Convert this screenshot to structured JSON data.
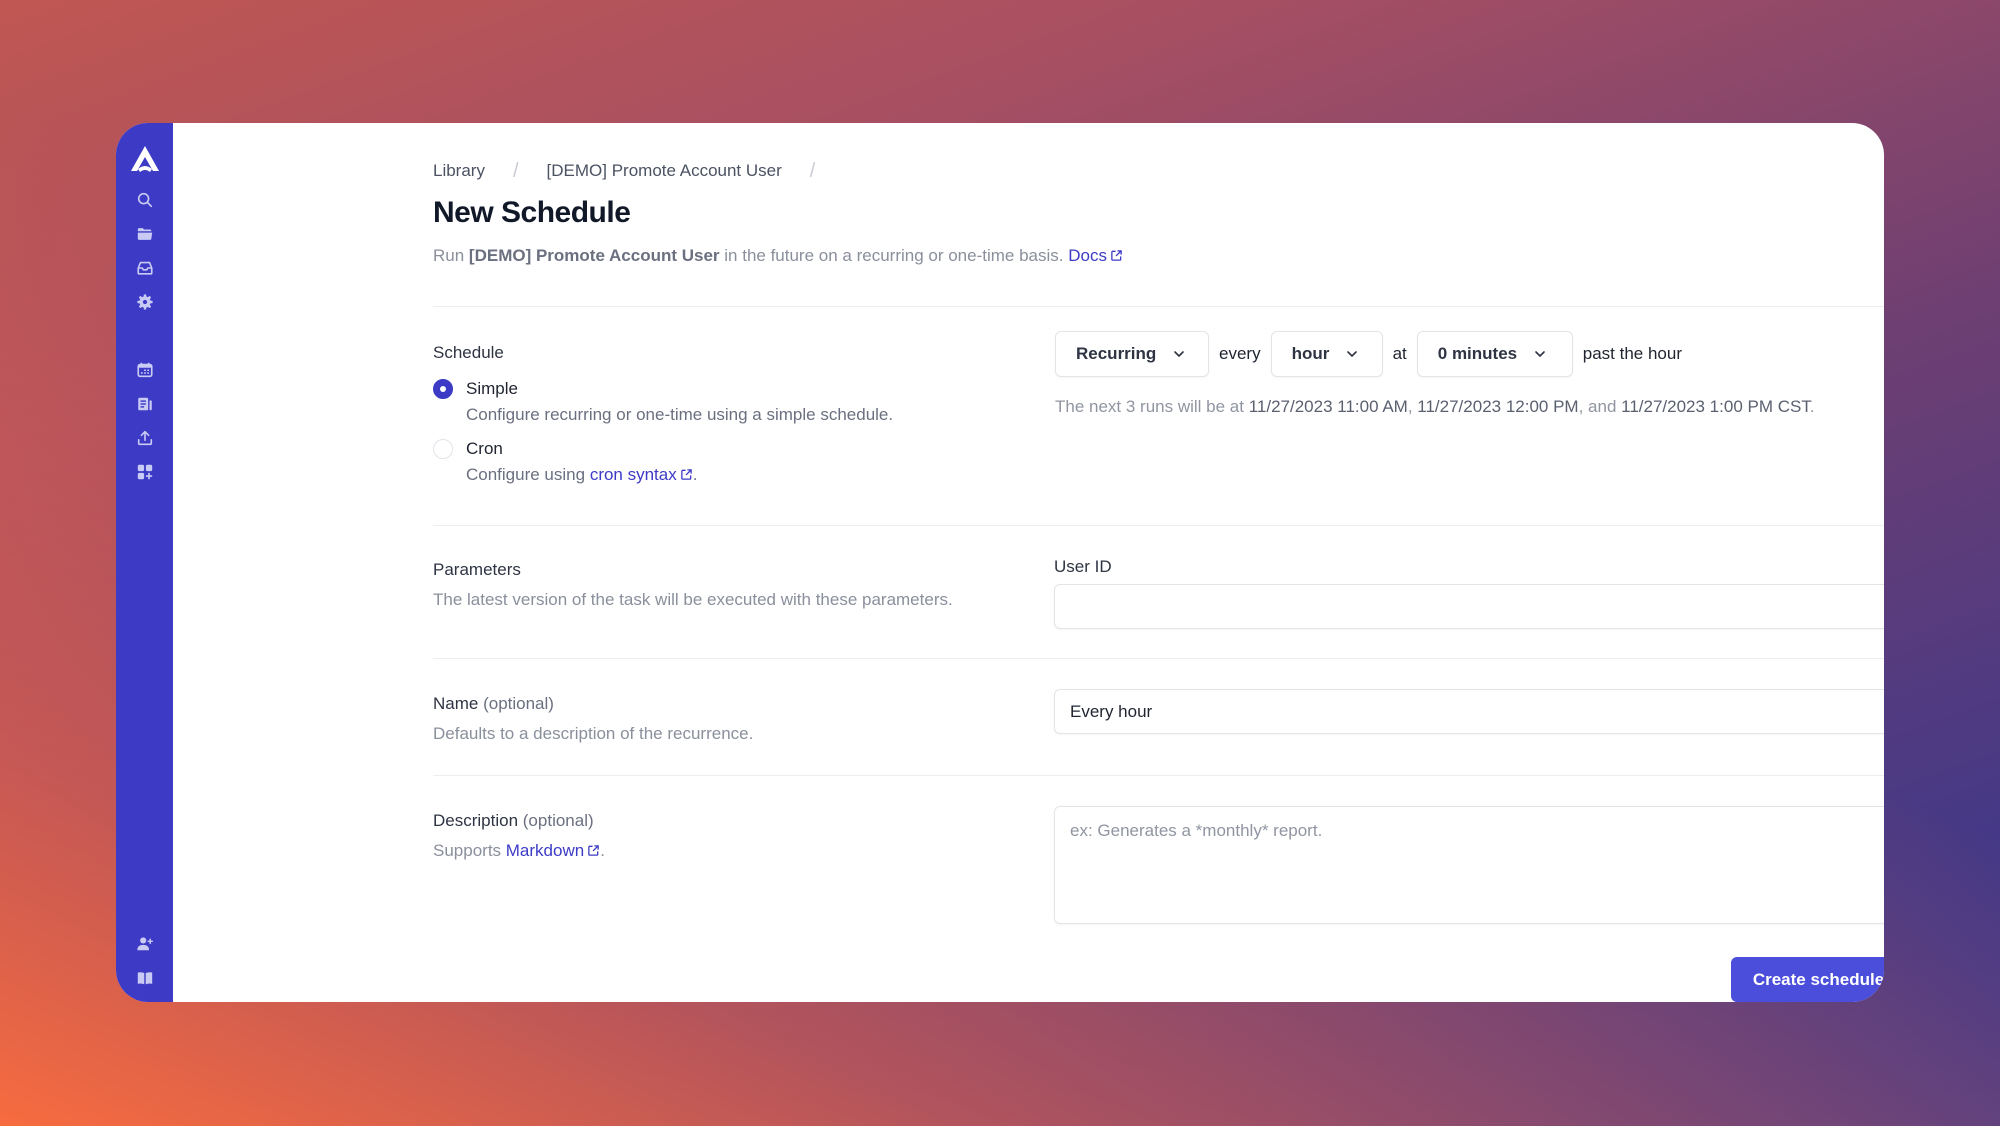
{
  "colors": {
    "accent": "#3d3bc6",
    "button": "#4b4ddb",
    "sidebar": "#3d3bc6"
  },
  "sidebar": {
    "logo": "airplane-logo",
    "top_items": [
      {
        "icon": "search-icon"
      },
      {
        "icon": "folder-icon"
      },
      {
        "icon": "inbox-icon"
      },
      {
        "icon": "gear-icon"
      }
    ],
    "middle_items": [
      {
        "icon": "calendar-icon"
      },
      {
        "icon": "runbook-icon"
      },
      {
        "icon": "upload-icon"
      },
      {
        "icon": "add-widget-icon"
      }
    ],
    "bottom_items": [
      {
        "icon": "add-user-icon"
      },
      {
        "icon": "book-icon"
      }
    ]
  },
  "breadcrumb": {
    "items": [
      "Library",
      "[DEMO] Promote Account User"
    ],
    "separator": "/"
  },
  "page": {
    "title": "New Schedule",
    "subtitle_prefix": "Run ",
    "subtitle_task": "[DEMO] Promote Account User",
    "subtitle_suffix": " in the future on a recurring or one-time basis. ",
    "docs_link": "Docs"
  },
  "schedule": {
    "label": "Schedule",
    "options": [
      {
        "label": "Simple",
        "description": "Configure recurring or one-time using a simple schedule.",
        "checked": true
      },
      {
        "label": "Cron",
        "description_prefix": "Configure using ",
        "description_link": "cron syntax",
        "description_suffix": ".",
        "checked": false
      }
    ],
    "controls": {
      "type_select": "Recurring",
      "every_word": "every",
      "interval_select": "hour",
      "at_word": "at",
      "minutes_select": "0 minutes",
      "suffix": "past the hour"
    },
    "next_runs": {
      "prefix": "The next 3 runs will be at ",
      "run1": "11/27/2023 11:00 AM",
      "sep1": ", ",
      "run2": "11/27/2023 12:00 PM",
      "sep2": ", and ",
      "run3": "11/27/2023 1:00 PM CST",
      "end": "."
    }
  },
  "parameters": {
    "label": "Parameters",
    "description": "The latest version of the task will be executed with these parameters.",
    "fields": [
      {
        "label": "User ID",
        "value": "",
        "placeholder": ""
      }
    ]
  },
  "name_section": {
    "label": "Name",
    "optional": " (optional)",
    "description": "Defaults to a description of the recurrence.",
    "value": "Every hour"
  },
  "description_section": {
    "label": "Description",
    "optional": " (optional)",
    "desc_prefix": "Supports ",
    "desc_link": "Markdown",
    "desc_suffix": ".",
    "placeholder": "ex: Generates a *monthly* report.",
    "value": ""
  },
  "actions": {
    "create_label": "Create schedule"
  }
}
